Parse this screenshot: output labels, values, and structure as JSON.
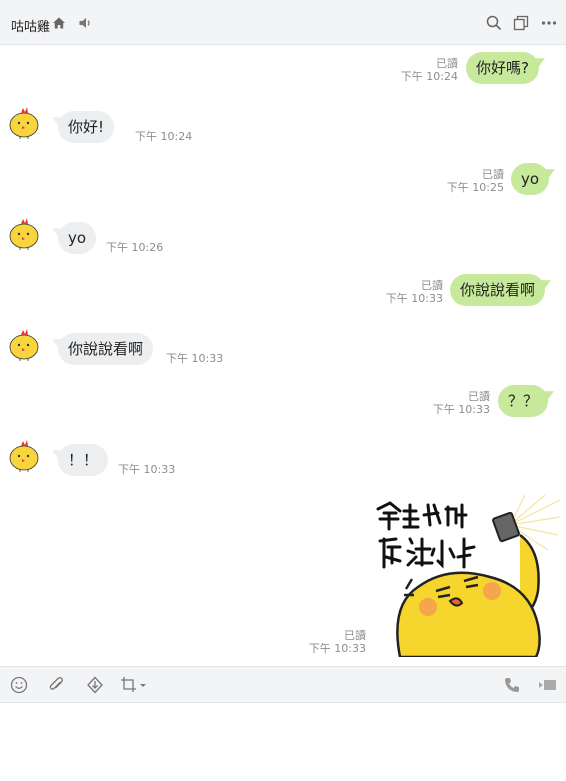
{
  "header": {
    "title": "咕咕雞",
    "icons": [
      "home-icon",
      "speaker-icon",
      "search-icon",
      "copy-icon",
      "more-icon"
    ]
  },
  "messages": [
    {
      "side": "out",
      "text": "你好嗎?",
      "read": "已讀",
      "time": "下午 10:24"
    },
    {
      "side": "in",
      "text": "你好!",
      "time": "下午 10:24"
    },
    {
      "side": "out",
      "text": "yo",
      "read": "已讀",
      "time": "下午 10:25"
    },
    {
      "side": "in",
      "text": "yo",
      "time": "下午 10:26"
    },
    {
      "side": "out",
      "text": "你說說看啊",
      "read": "已讀",
      "time": "下午 10:33"
    },
    {
      "side": "in",
      "text": "你說說看啊",
      "time": "下午 10:33"
    },
    {
      "side": "out",
      "text": "？？",
      "read": "已讀",
      "time": "下午 10:33"
    },
    {
      "side": "in",
      "text": "！！",
      "time": "下午 10:33"
    },
    {
      "side": "out",
      "type": "sticker",
      "sticker_text": "拿出我的魔法小卡",
      "read": "已讀",
      "time": "下午 10:33"
    }
  ],
  "toolbar": {
    "icons": [
      "emoji-icon",
      "attach-icon",
      "download-icon",
      "crop-icon",
      "phone-icon",
      "video-icon"
    ]
  },
  "colors": {
    "outgoing_bubble": "#c6e99b",
    "incoming_bubble": "#eceef0",
    "header_bg": "#f3f4f6"
  }
}
